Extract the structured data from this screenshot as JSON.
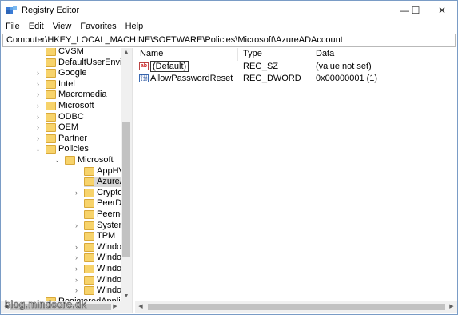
{
  "window": {
    "title": "Registry Editor",
    "controls": {
      "minimize": "—",
      "maximize": "☐",
      "close": "✕"
    }
  },
  "menu": [
    "File",
    "Edit",
    "View",
    "Favorites",
    "Help"
  ],
  "address": "Computer\\HKEY_LOCAL_MACHINE\\SOFTWARE\\Policies\\Microsoft\\AzureADAccount",
  "tree": {
    "items": [
      {
        "label": "CVSM",
        "expandable": false
      },
      {
        "label": "DefaultUserEnvironn",
        "expandable": false
      },
      {
        "label": "Google",
        "expandable": true
      },
      {
        "label": "Intel",
        "expandable": true
      },
      {
        "label": "Macromedia",
        "expandable": true
      },
      {
        "label": "Microsoft",
        "expandable": true
      },
      {
        "label": "ODBC",
        "expandable": true
      },
      {
        "label": "OEM",
        "expandable": true
      },
      {
        "label": "Partner",
        "expandable": true
      },
      {
        "label": "Policies",
        "expandable": true,
        "expanded": true
      },
      {
        "label": "Microsoft",
        "expandable": true,
        "expanded": true
      },
      {
        "label": "AppHVSI",
        "expandable": false
      },
      {
        "label": "AzureADAccou",
        "expandable": false,
        "selected": true
      },
      {
        "label": "Cryptography",
        "expandable": true
      },
      {
        "label": "PeerDist",
        "expandable": false
      },
      {
        "label": "Peernet",
        "expandable": false
      },
      {
        "label": "SystemCertific",
        "expandable": true
      },
      {
        "label": "TPM",
        "expandable": false
      },
      {
        "label": "Windows",
        "expandable": true
      },
      {
        "label": "Windows Adva",
        "expandable": true
      },
      {
        "label": "Windows Defe",
        "expandable": true
      },
      {
        "label": "Windows Defe",
        "expandable": true
      },
      {
        "label": "Windows NT",
        "expandable": true
      },
      {
        "label": "RegisteredApplicatio",
        "expandable": false
      }
    ]
  },
  "list": {
    "columns": [
      "Name",
      "Type",
      "Data"
    ],
    "rows": [
      {
        "name": "(Default)",
        "type": "REG_SZ",
        "data": "(value not set)",
        "icon": "string-value-icon"
      },
      {
        "name": "AllowPasswordReset",
        "type": "REG_DWORD",
        "data": "0x00000001 (1)",
        "icon": "binary-value-icon"
      }
    ]
  },
  "watermark": "blog.mindcore.dk"
}
